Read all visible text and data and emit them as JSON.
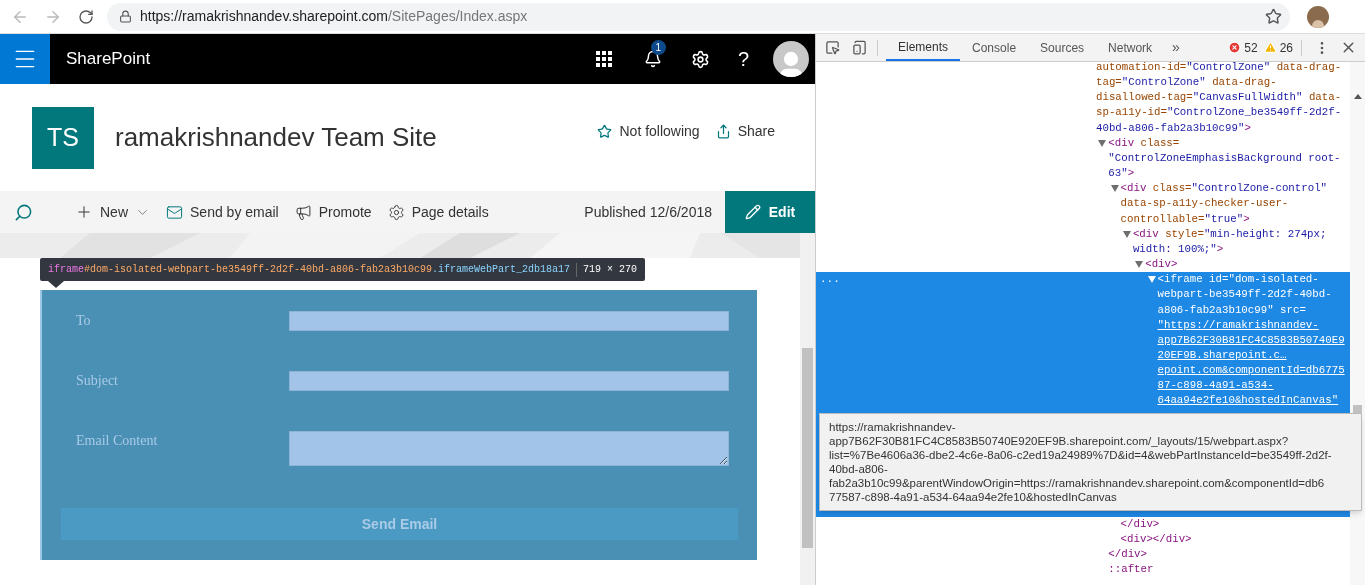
{
  "browser": {
    "url_host": "https://ramakrishnandev.sharepoint.com",
    "url_path": "/SitePages/Index.aspx"
  },
  "suite_bar": {
    "app_name": "SharePoint",
    "notification_count": "1",
    "help": "?"
  },
  "site": {
    "logo": "TS",
    "title": "ramakrishnandev Team Site",
    "actions": [
      {
        "kind": "follow",
        "label": "Not following"
      },
      {
        "kind": "share",
        "label": "Share"
      }
    ]
  },
  "command_bar": {
    "commands": [
      {
        "kind": "new",
        "label": "New"
      },
      {
        "kind": "email",
        "label": "Send by email"
      },
      {
        "kind": "promote",
        "label": "Promote"
      },
      {
        "kind": "details",
        "label": "Page details"
      }
    ],
    "status": "Published 12/6/2018",
    "edit": "Edit"
  },
  "inspector_label": {
    "tag": "iframe",
    "id": "#dom-isolated-webpart-be3549ff-2d2f-40bd-a806-fab2a3b10c99",
    "class_name": ".iframeWebPart_2db18a17",
    "size": "719 × 270"
  },
  "form": {
    "fields": [
      {
        "kind": "input",
        "label": "To"
      },
      {
        "kind": "input",
        "label": "Subject"
      },
      {
        "kind": "textarea",
        "label": "Email Content"
      }
    ],
    "submit": "Send Email"
  },
  "devtools": {
    "tabs": [
      {
        "label": "Elements",
        "selected": true
      },
      {
        "label": "Console",
        "selected": false
      },
      {
        "label": "Sources",
        "selected": false
      },
      {
        "label": "Network",
        "selected": false
      }
    ],
    "more": "»",
    "errors": "52",
    "warnings": "26",
    "gutter": "...",
    "tree": [
      {
        "selected": false,
        "lines": [
          "automation-id=\"ControlZone\" data-drag-",
          "tag=\"ControlZone\" data-drag-",
          "disallowed-tag=\"CanvasFullWidth\" data-",
          "sp-a11y-id=\"ControlZone_be3549ff-2d2f-",
          "40bd-a806-fab2a3b10c99\">"
        ],
        "children": [
          {
            "selected": false,
            "expanded": true,
            "lines": [
              "<div class=",
              "\"ControlZoneEmphasisBackground root-",
              "63\">"
            ],
            "closing": "</div>",
            "children": [
              {
                "selected": false,
                "expanded": true,
                "lines": [
                  "<div class=\"ControlZone-control\"",
                  "data-sp-a11y-checker-user-",
                  "controllable=\"true\">"
                ],
                "closing": "</div>",
                "children": [
                  {
                    "selected": false,
                    "expanded": true,
                    "lines": [
                      "<div style=\"min-height: 274px;",
                      "width: 100%;\">"
                    ],
                    "children": [
                      {
                        "selected": false,
                        "expanded": true,
                        "lines": [
                          "<div>"
                        ],
                        "children": [
                          {
                            "selected": true,
                            "expanded": true,
                            "lines": [
                              "<iframe id=\"dom-isolated-",
                              "webpart-be3549ff-2d2f-40bd-",
                              "a806-fab2a3b10c99\" src="
                            ],
                            "link_lines": [
                              "\"https://ramakrishnandev-",
                              "app7B62F30B81FC4C8583B50740E9",
                              "20EF9B.sharepoint.c…",
                              "epoint.com&componentId=db6775",
                              "87-c898-4a91-a534-",
                              "64aa94e2fe10&hostedInCanvas\""
                            ]
                          }
                        ]
                      }
                    ]
                  }
                ]
              },
              {
                "selected": false,
                "lines": [
                  "<div></div>"
                ]
              }
            ]
          },
          {
            "selected": false,
            "lines": [
              "::after"
            ]
          }
        ]
      }
    ],
    "tooltip": {
      "lines": [
        "https://ramakrishnandev-",
        "app7B62F30B81FC4C8583B50740E920EF9B.sharepoint.com/_layouts/15/webpart.aspx?",
        "list=%7Be4606a36-dbe2-4c6e-8a06-c2ed19a24989%7D&id=4&webPartInstanceId=be3549ff-2d2f-",
        "40bd-a806-",
        "fab2a3b10c99&parentWindowOrigin=https://ramakrishnandev.sharepoint.com&componentId=db6",
        "77587-c898-4a91-a534-64aa94e2fe10&hostedInCanvas"
      ]
    }
  }
}
